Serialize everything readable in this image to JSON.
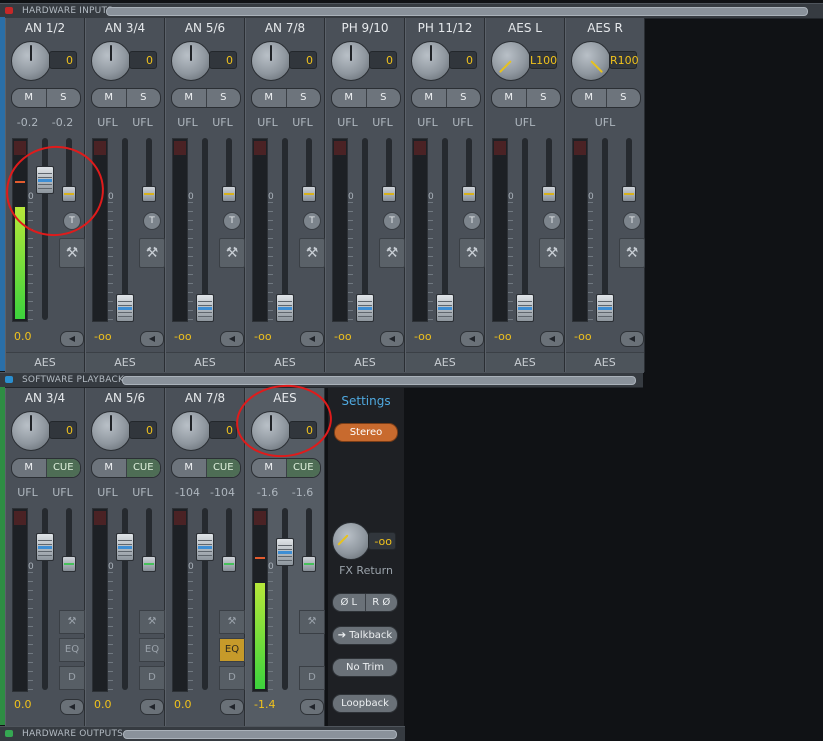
{
  "sections": {
    "hardware_inputs": "HARDWARE INPUTS",
    "software_playback": "SOFTWARE PLAYBACK",
    "hardware_outputs": "HARDWARE OUTPUTS"
  },
  "inputs": [
    {
      "name": "AN 1/2",
      "pan": "0",
      "mute": "M",
      "solo": "S",
      "levels": [
        "-0.2",
        "-0.2"
      ],
      "zero": "0",
      "trim": "T",
      "volume": "0.0",
      "output": "AES"
    },
    {
      "name": "AN 3/4",
      "pan": "0",
      "mute": "M",
      "solo": "S",
      "levels": [
        "UFL",
        "UFL"
      ],
      "zero": "0",
      "trim": "T",
      "volume": "-oo",
      "output": "AES"
    },
    {
      "name": "AN 5/6",
      "pan": "0",
      "mute": "M",
      "solo": "S",
      "levels": [
        "UFL",
        "UFL"
      ],
      "zero": "0",
      "trim": "T",
      "volume": "-oo",
      "output": "AES"
    },
    {
      "name": "AN 7/8",
      "pan": "0",
      "mute": "M",
      "solo": "S",
      "levels": [
        "UFL",
        "UFL"
      ],
      "zero": "0",
      "trim": "T",
      "volume": "-oo",
      "output": "AES"
    },
    {
      "name": "PH 9/10",
      "pan": "0",
      "mute": "M",
      "solo": "S",
      "levels": [
        "UFL",
        "UFL"
      ],
      "zero": "0",
      "trim": "T",
      "volume": "-oo",
      "output": "AES"
    },
    {
      "name": "PH 11/12",
      "pan": "0",
      "mute": "M",
      "solo": "S",
      "levels": [
        "UFL",
        "UFL"
      ],
      "zero": "0",
      "trim": "T",
      "volume": "-oo",
      "output": "AES"
    },
    {
      "name": "AES L",
      "pan": "L100",
      "mute": "M",
      "solo": "S",
      "levels": [
        "UFL"
      ],
      "zero": "0",
      "trim": "T",
      "volume": "-oo",
      "output": "AES"
    },
    {
      "name": "AES R",
      "pan": "R100",
      "mute": "M",
      "solo": "S",
      "levels": [
        "UFL"
      ],
      "zero": "0",
      "trim": "T",
      "volume": "-oo",
      "output": "AES"
    }
  ],
  "playback": [
    {
      "name": "AN 3/4",
      "pan": "0",
      "mute": "M",
      "cue": "CUE",
      "levels": [
        "UFL",
        "UFL"
      ],
      "zero": "0",
      "eq": "EQ",
      "dyn": "D",
      "volume": "0.0"
    },
    {
      "name": "AN 5/6",
      "pan": "0",
      "mute": "M",
      "cue": "CUE",
      "levels": [
        "UFL",
        "UFL"
      ],
      "zero": "0",
      "eq": "EQ",
      "dyn": "D",
      "volume": "0.0"
    },
    {
      "name": "AN 7/8",
      "pan": "0",
      "mute": "M",
      "cue": "CUE",
      "levels": [
        "-104",
        "-104"
      ],
      "zero": "0",
      "eq": "EQ",
      "dyn": "D",
      "volume": "0.0"
    },
    {
      "name": "AES",
      "pan": "0",
      "mute": "M",
      "cue": "CUE",
      "levels": [
        "-1.6",
        "-1.6"
      ],
      "zero": "0",
      "dyn": "D",
      "volume": "-1.4"
    }
  ],
  "settings": {
    "title": "Settings",
    "stereo": "Stereo",
    "fx_value": "-oo",
    "fx_label": "FX Return",
    "phase_l": "Ø L",
    "phase_r": "R Ø",
    "talkback": "➔ Talkback",
    "no_trim": "No Trim",
    "loopback": "Loopback"
  },
  "icons": [
    "wrench-icon",
    "left-arrow-icon",
    "trim-icon",
    "phase-icon"
  ],
  "colors": {
    "value_text": "#f0c21c",
    "meter": "#3cd23c",
    "stereo": "#c86a2e",
    "settings_title": "#4fa9e0",
    "annotation": "#e01b1b"
  }
}
